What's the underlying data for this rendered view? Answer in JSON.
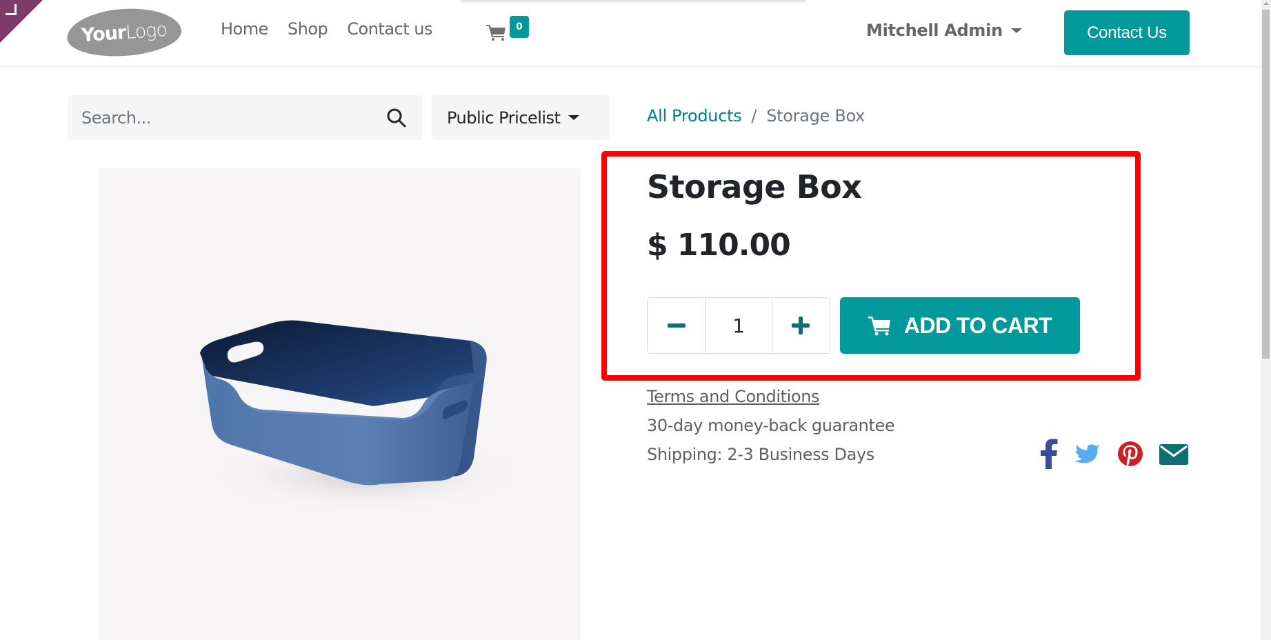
{
  "header": {
    "logo_text_bold": "Your",
    "logo_text_light": "Logo",
    "nav_items": [
      {
        "label": "Home"
      },
      {
        "label": "Shop"
      },
      {
        "label": "Contact us"
      }
    ],
    "cart_count": "0",
    "user_name": "Mitchell Admin",
    "contact_button": "Contact Us"
  },
  "search": {
    "placeholder": "Search...",
    "value": ""
  },
  "pricelist": {
    "selected": "Public Pricelist"
  },
  "breadcrumb": {
    "parent": "All Products",
    "separator": "/",
    "current": "Storage Box"
  },
  "product": {
    "name": "Storage Box",
    "price": "$ 110.00",
    "quantity": "1",
    "add_to_cart_label": "ADD TO CART",
    "terms_label": "Terms and Conditions",
    "guarantee": "30-day money-back guarantee",
    "shipping": "Shipping: 2-3 Business Days",
    "image_alt": "Blue storage box"
  },
  "share": {
    "icons": [
      "facebook-icon",
      "twitter-icon",
      "pinterest-icon",
      "email-icon"
    ]
  },
  "colors": {
    "primary": "#01999b",
    "primary_dark": "#0e6e70",
    "highlight": "#ff0000",
    "corner": "#7c3b6a",
    "facebook": "#3b4d9a",
    "twitter": "#55acee",
    "pinterest": "#cb2027",
    "email": "#0e6e70"
  }
}
